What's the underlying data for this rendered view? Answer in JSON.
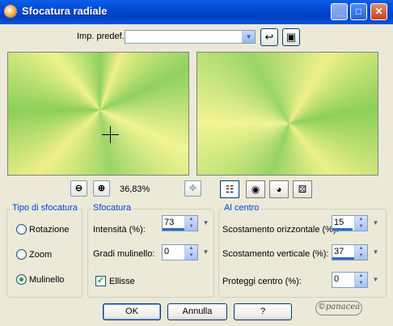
{
  "window": {
    "title": "Sfocatura radiale"
  },
  "preset": {
    "label": "Imp. predef.:",
    "value": ""
  },
  "zoom": {
    "level": "36,83%"
  },
  "blur_type": {
    "title": "Tipo di sfocatura",
    "options": [
      {
        "label": "Rotazione",
        "checked": false
      },
      {
        "label": "Zoom",
        "checked": false
      },
      {
        "label": "Mulinello",
        "checked": true
      }
    ]
  },
  "blur": {
    "title": "Sfocatura",
    "intensity": {
      "label": "Intensità (%):",
      "value": "73",
      "fill": 0.73
    },
    "twirl": {
      "label": "Gradi mulinello:",
      "value": "0",
      "fill": 0.0
    },
    "ellipse": {
      "label": "Ellisse",
      "checked": true
    }
  },
  "center": {
    "title": "Al centro",
    "h_offset": {
      "label": "Scostamento orizzontale (%):",
      "value": "15",
      "fill": 0.57
    },
    "v_offset": {
      "label": "Scostamento verticale (%):",
      "value": "37",
      "fill": 0.68
    },
    "protect": {
      "label": "Proteggi centro (%):",
      "value": "0",
      "fill": 0.0
    }
  },
  "buttons": {
    "ok": "OK",
    "cancel": "Annulla",
    "help": "?"
  },
  "logo_text": "©panacea",
  "colors": {
    "title_bar": "#0049d1",
    "group_title": "#0046d5",
    "accent": "#316ac5"
  }
}
